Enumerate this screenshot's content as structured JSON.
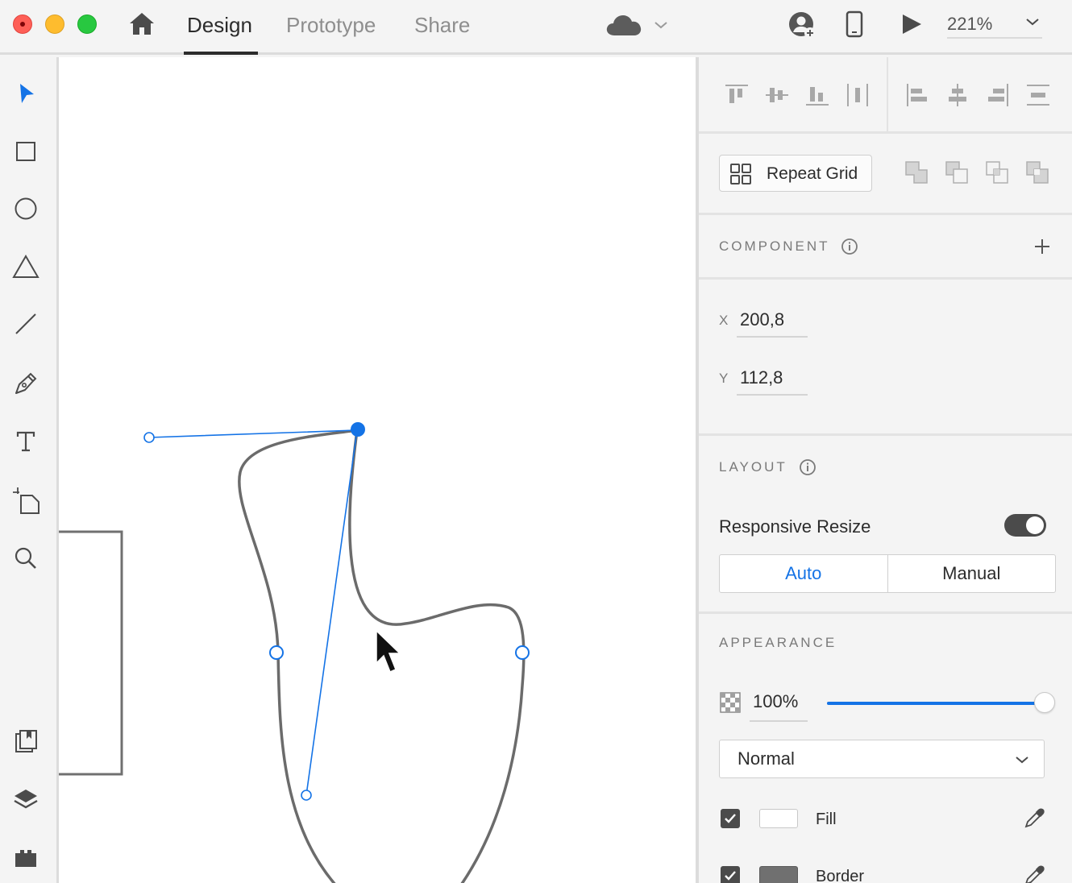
{
  "window": {
    "tabs": [
      {
        "label": "Design",
        "active": true
      },
      {
        "label": "Prototype",
        "active": false
      },
      {
        "label": "Share",
        "active": false
      }
    ],
    "zoom": "221%"
  },
  "toolbar": {
    "tools": [
      "select-tool",
      "rectangle-tool",
      "ellipse-tool",
      "polygon-tool",
      "line-tool",
      "pen-tool",
      "text-tool",
      "artboard-tool",
      "zoom-tool"
    ],
    "bottom_tools": [
      "assets-panel",
      "layers-panel",
      "plugins-panel"
    ],
    "active_tool": "select-tool"
  },
  "panel": {
    "repeat_grid_label": "Repeat Grid",
    "component": {
      "title": "COMPONENT"
    },
    "coords": {
      "x_label": "X",
      "x_value": "200,8",
      "y_label": "Y",
      "y_value": "112,8"
    },
    "layout": {
      "title": "LAYOUT",
      "responsive_resize_label": "Responsive Resize",
      "responsive_resize_on": true,
      "modes": [
        "Auto",
        "Manual"
      ],
      "active_mode": "Auto"
    },
    "appearance": {
      "title": "APPEARANCE",
      "opacity_text": "100%",
      "opacity": 1.0,
      "blend_mode": "Normal",
      "fill": {
        "label": "Fill",
        "enabled": true,
        "color": "#ffffff"
      },
      "border": {
        "label": "Border",
        "enabled": true,
        "color": "#707070"
      }
    }
  },
  "colors": {
    "accent": "#1473e6",
    "path_stroke": "#6b6b6b",
    "handle": "#1473e6"
  }
}
